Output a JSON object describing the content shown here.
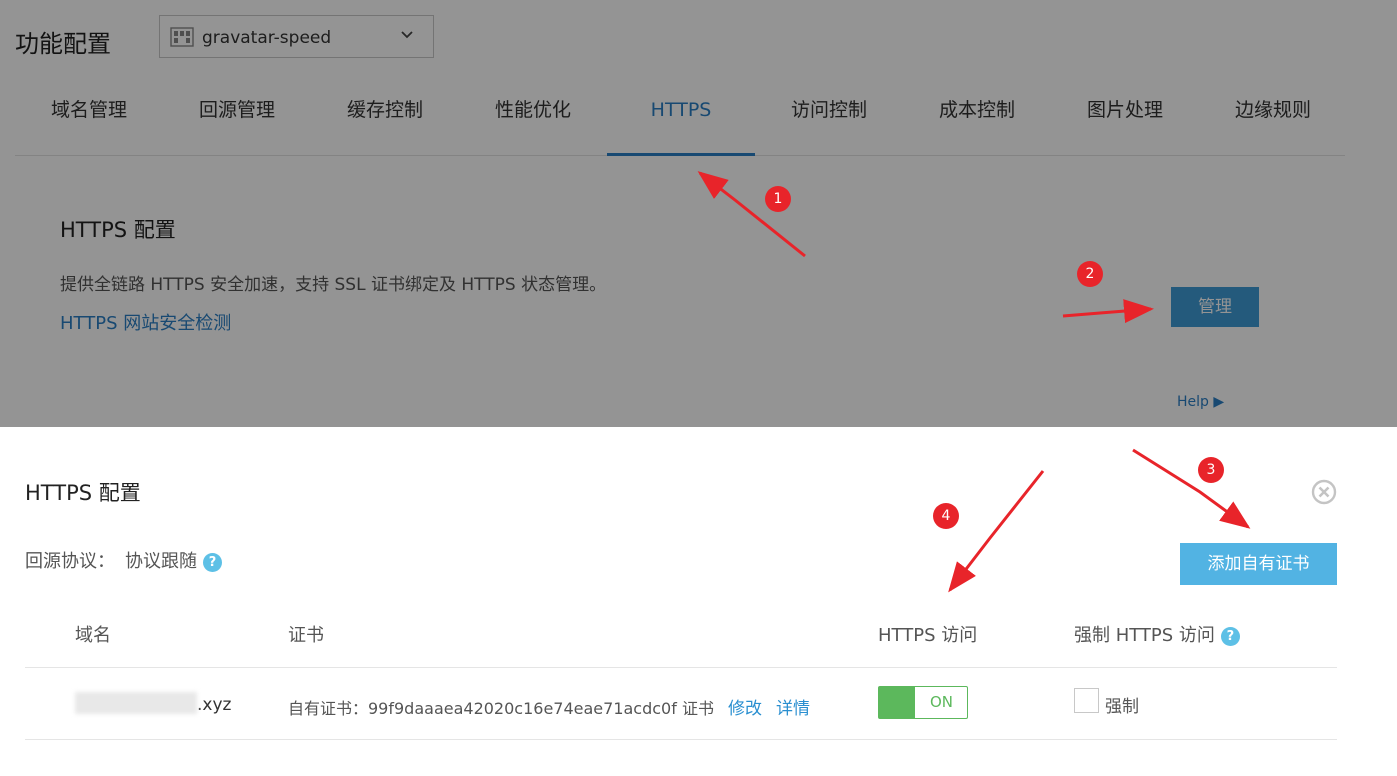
{
  "header": {
    "title": "功能配置",
    "domain_select": {
      "value": "gravatar-speed",
      "icon": "domain-grid-icon"
    }
  },
  "nav": {
    "tabs": [
      {
        "label": "域名管理"
      },
      {
        "label": "回源管理"
      },
      {
        "label": "缓存控制"
      },
      {
        "label": "性能优化"
      },
      {
        "label": "HTTPS",
        "active": true
      },
      {
        "label": "访问控制"
      },
      {
        "label": "成本控制"
      },
      {
        "label": "图片处理"
      },
      {
        "label": "边缘规则"
      }
    ]
  },
  "https_section": {
    "title": "HTTPS 配置",
    "description": "提供全链路 HTTPS 安全加速，支持 SSL 证书绑定及 HTTPS 状态管理。",
    "check_link": "HTTPS 网站安全检测",
    "manage_button": "管理",
    "help_link": "Help ▶"
  },
  "modal": {
    "title": "HTTPS 配置",
    "origin_protocol_label": "回源协议：",
    "origin_protocol_value": "协议跟随",
    "add_cert_button": "添加自有证书",
    "help_glyph": "?",
    "table": {
      "columns": [
        "域名",
        "证书",
        "HTTPS 访问",
        "强制 HTTPS 访问"
      ],
      "rows": [
        {
          "domain_suffix": ".xyz",
          "cert_text": "自有证书：99f9daaaea42020c16e74eae71acdc0f 证书",
          "edit_link": "修改",
          "detail_link": "详情",
          "https_toggle": "ON",
          "force_label": "强制"
        }
      ]
    }
  },
  "annotations": {
    "markers": [
      "1",
      "2",
      "3",
      "4"
    ],
    "color": "#e8242a"
  },
  "colors": {
    "accent": "#2a7fc4",
    "button": "#52b3e3",
    "toggle_on": "#5cb85c"
  }
}
